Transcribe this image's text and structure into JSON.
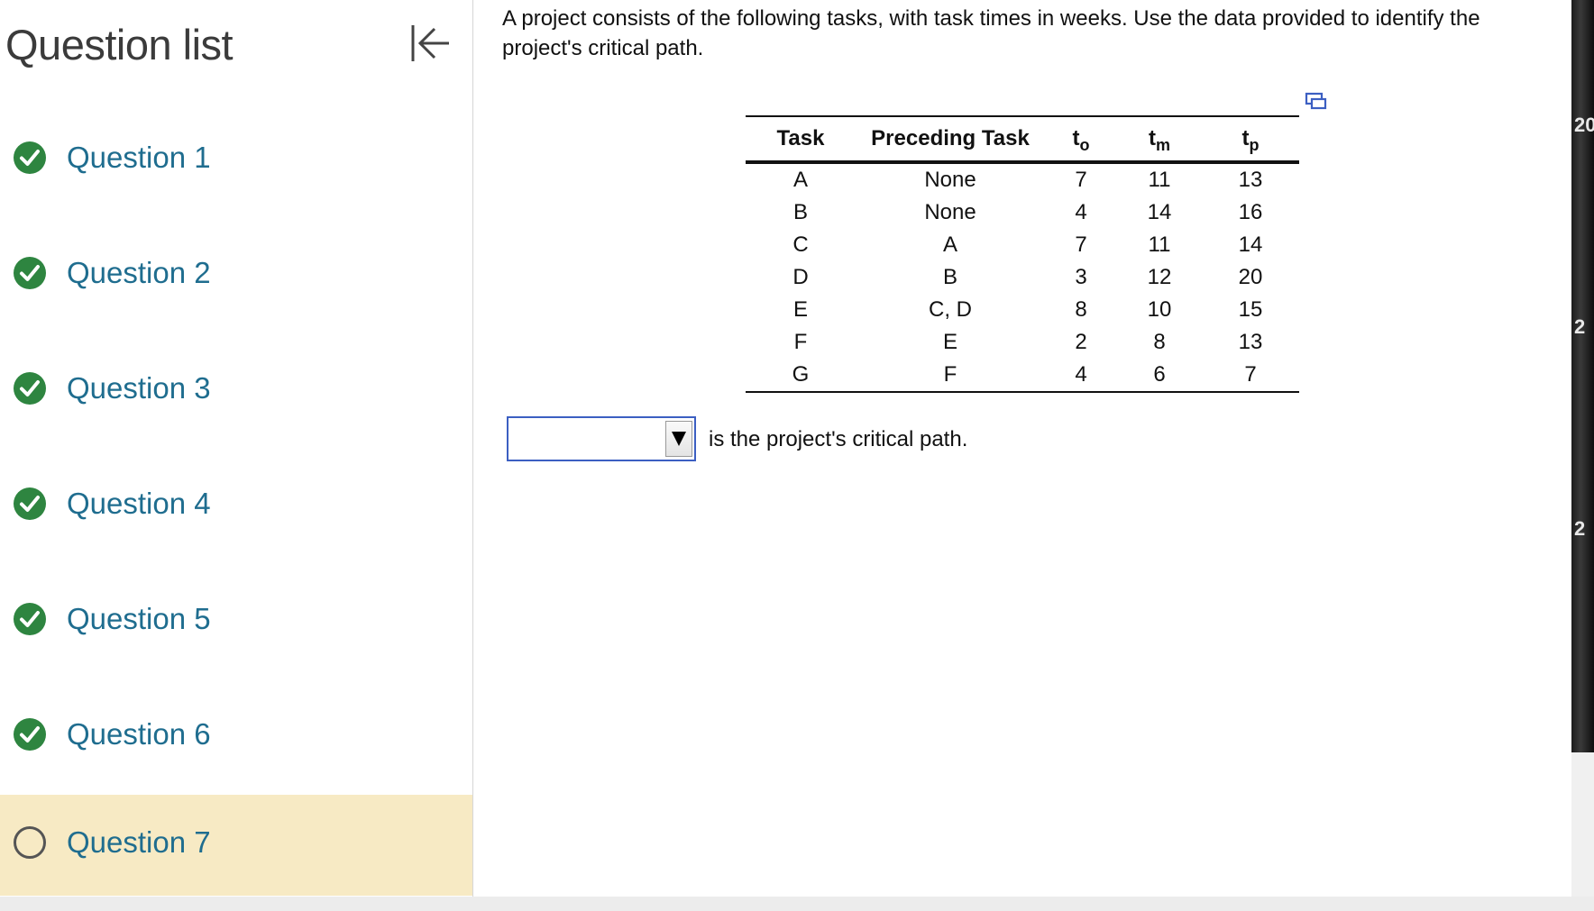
{
  "sidebar": {
    "title": "Question list",
    "items": [
      {
        "label": "Question 1",
        "status": "complete"
      },
      {
        "label": "Question 2",
        "status": "complete"
      },
      {
        "label": "Question 3",
        "status": "complete"
      },
      {
        "label": "Question 4",
        "status": "complete"
      },
      {
        "label": "Question 5",
        "status": "complete"
      },
      {
        "label": "Question 6",
        "status": "complete"
      },
      {
        "label": "Question 7",
        "status": "current"
      }
    ]
  },
  "question": {
    "prompt": "A project consists of the following tasks, with task times in weeks. Use the data provided to identify the project's critical path.",
    "table": {
      "headers": {
        "task": "Task",
        "preceding": "Preceding Task",
        "to": {
          "main": "t",
          "sub": "o"
        },
        "tm": {
          "main": "t",
          "sub": "m"
        },
        "tp": {
          "main": "t",
          "sub": "p"
        }
      },
      "rows": [
        {
          "task": "A",
          "preceding": "None",
          "to": "7",
          "tm": "11",
          "tp": "13"
        },
        {
          "task": "B",
          "preceding": "None",
          "to": "4",
          "tm": "14",
          "tp": "16"
        },
        {
          "task": "C",
          "preceding": "A",
          "to": "7",
          "tm": "11",
          "tp": "14"
        },
        {
          "task": "D",
          "preceding": "B",
          "to": "3",
          "tm": "12",
          "tp": "20"
        },
        {
          "task": "E",
          "preceding": "C, D",
          "to": "8",
          "tm": "10",
          "tp": "15"
        },
        {
          "task": "F",
          "preceding": "E",
          "to": "2",
          "tm": "8",
          "tp": "13"
        },
        {
          "task": "G",
          "preceding": "F",
          "to": "4",
          "tm": "6",
          "tp": "7"
        }
      ]
    },
    "answer": {
      "selected": "",
      "suffix": "is the project's critical path."
    }
  },
  "right_edge": {
    "labels": [
      "20",
      "2",
      "2"
    ]
  },
  "colors": {
    "check_green": "#2e8540",
    "link_blue": "#1f6d8f",
    "active_bg": "#f7eac4",
    "select_border": "#3c5fc2"
  }
}
